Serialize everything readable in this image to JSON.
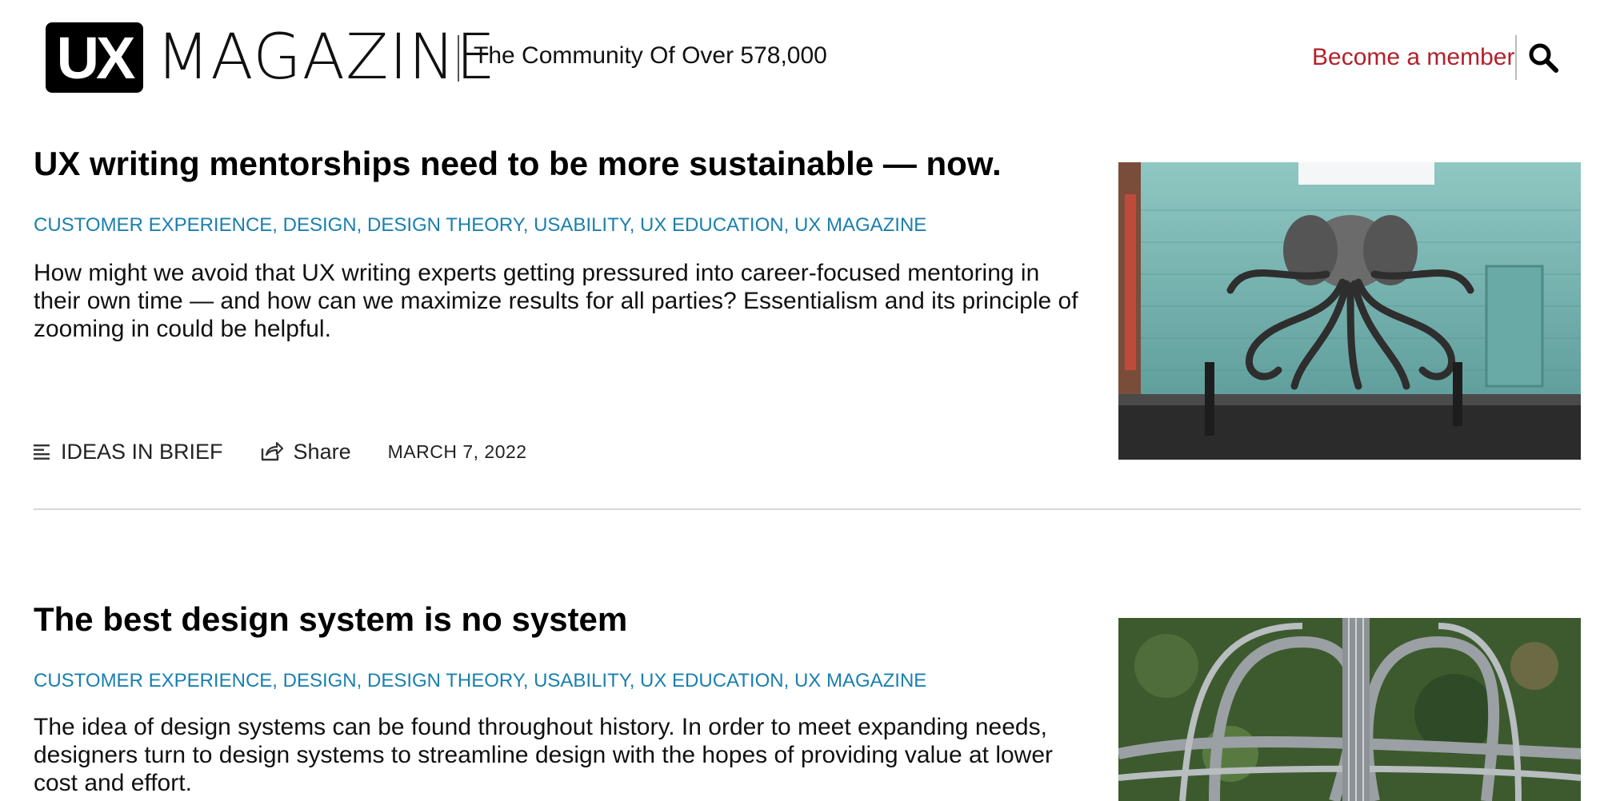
{
  "header": {
    "logo_mark": "UX",
    "logo_word": "MAGAZINE",
    "tagline": "The Community Of Over 578,000",
    "member_link": "Become a member",
    "search_icon": "search-icon",
    "accent_color": "#b3202a"
  },
  "articles": [
    {
      "title": "UX writing mentorships need to be more sustainable — now.",
      "tags": [
        "CUSTOMER EXPERIENCE",
        "DESIGN",
        "DESIGN THEORY",
        "USABILITY",
        "UX EDUCATION",
        "UX MAGAZINE"
      ],
      "excerpt": "How might we avoid that UX writing experts getting pressured into career-focused mentoring in their own time — and how can we maximize results for all parties? Essentialism and its principle of zooming in could be helpful.",
      "meta": {
        "category_icon": "list-icon",
        "category": "IDEAS IN BRIEF",
        "share_icon": "share-icon",
        "share_label": "Share",
        "date": "MARCH 7, 2022"
      },
      "image": "elephant-octopus-mural-photo"
    },
    {
      "title": "The best design system is no system",
      "tags": [
        "CUSTOMER EXPERIENCE",
        "DESIGN",
        "DESIGN THEORY",
        "USABILITY",
        "UX EDUCATION",
        "UX MAGAZINE"
      ],
      "excerpt": "The idea of design systems can be found throughout history. In order to meet expanding needs, designers turn to design systems to streamline design with the hopes of providing value at lower cost and effort.",
      "image": "highway-interchange-aerial-photo"
    }
  ],
  "tag_color": "#1a7fae"
}
